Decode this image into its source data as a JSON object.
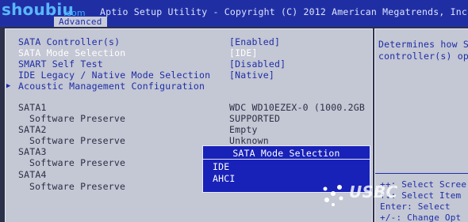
{
  "header": {
    "title": "Aptio Setup Utility - Copyright (C) 2012 American Megatrends, Inc.",
    "tab": "Advanced"
  },
  "logos": {
    "top_left": "shoubiu",
    "top_left_sub": ".com",
    "bottom_right": "USBC"
  },
  "settings": [
    {
      "label": "SATA Controller(s)",
      "value": "[Enabled]"
    },
    {
      "label": "SATA Mode Selection",
      "value": "[IDE]"
    },
    {
      "label": "SMART Self Test",
      "value": "[Disabled]"
    },
    {
      "label": "IDE Legacy / Native Mode Selection",
      "value": "[Native]"
    },
    {
      "label": "Acoustic Management Configuration",
      "value": ""
    }
  ],
  "ports": [
    {
      "label": "SATA1",
      "value": "WDC WD10EZEX-0 (1000.2GB"
    },
    {
      "label": "Software Preserve",
      "value": "SUPPORTED"
    },
    {
      "label": "SATA2",
      "value": "Empty"
    },
    {
      "label": "Software Preserve",
      "value": "Unknown"
    },
    {
      "label": "SATA3",
      "value": ""
    },
    {
      "label": "Software Preserve",
      "value": ""
    },
    {
      "label": "SATA4",
      "value": ""
    },
    {
      "label": "Software Preserve",
      "value": ""
    }
  ],
  "help": {
    "text": "Determines how S\ncontroller(s) op",
    "keys": [
      "++: Select Scree",
      "↑↓: Select Item",
      "Enter: Select",
      "+/-: Change Opt"
    ]
  },
  "popup": {
    "title": "SATA Mode Selection",
    "options": [
      "IDE",
      "AHCI"
    ]
  }
}
